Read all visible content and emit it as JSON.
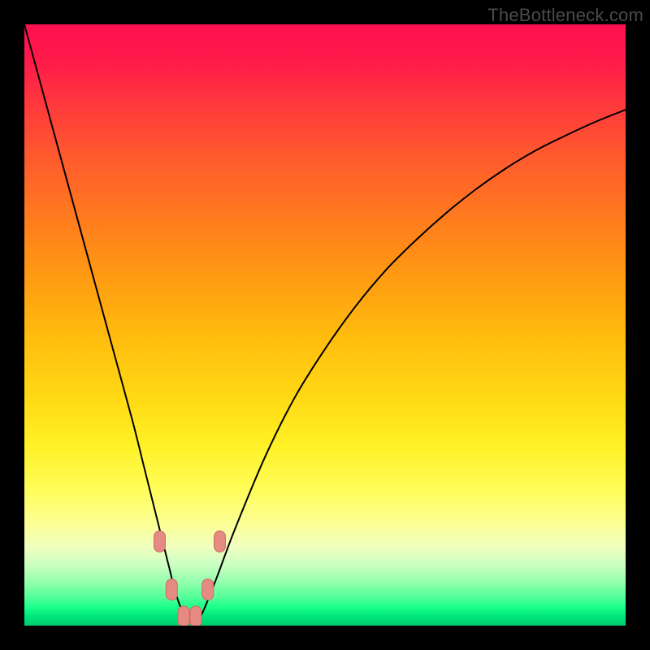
{
  "watermark": "TheBottleneck.com",
  "colors": {
    "frame": "#000000",
    "curve_stroke": "#000000",
    "marker_fill": "#e58b83",
    "marker_stroke": "#d16a62",
    "gradient_top": "#ff1050",
    "gradient_bottom": "#00cc70"
  },
  "chart_data": {
    "type": "line",
    "title": "",
    "xlabel": "",
    "ylabel": "",
    "xlim": [
      0,
      100
    ],
    "ylim": [
      0,
      100
    ],
    "grid": false,
    "legend": false,
    "series": [
      {
        "name": "bottleneck-curve",
        "x": [
          0,
          3,
          6,
          9,
          12,
          15,
          18,
          20,
          22,
          24,
          25,
          26,
          27,
          28,
          29,
          30,
          32,
          35,
          40,
          45,
          50,
          55,
          60,
          65,
          70,
          75,
          80,
          85,
          90,
          95,
          100
        ],
        "y": [
          100,
          89,
          78,
          67,
          56,
          45,
          34,
          26,
          18,
          10,
          6,
          3,
          1,
          0.5,
          1,
          3,
          8,
          16,
          28,
          38,
          46,
          53,
          59,
          64,
          68.5,
          72.5,
          76,
          79,
          81.5,
          83.8,
          85.8
        ]
      }
    ],
    "markers": [
      {
        "x": 22.5,
        "y": 14
      },
      {
        "x": 24.5,
        "y": 6
      },
      {
        "x": 26.5,
        "y": 1.5
      },
      {
        "x": 28.5,
        "y": 1.5
      },
      {
        "x": 30.5,
        "y": 6
      },
      {
        "x": 32.5,
        "y": 14
      }
    ]
  }
}
